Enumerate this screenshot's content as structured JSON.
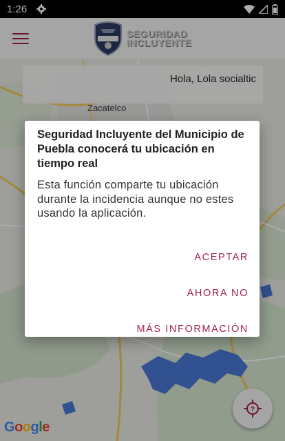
{
  "status_bar": {
    "time": "1:26",
    "icons": [
      "settings-gear-icon",
      "wifi-icon",
      "signal-icon",
      "battery-icon"
    ]
  },
  "app_bar": {
    "logo_line1": "SEGURIDAD",
    "logo_line2": "INCLUYENTE",
    "menu_icon": "hamburger-menu-icon"
  },
  "map": {
    "greeting": "Hola, Lola socialtic",
    "place_label": "Zacatelco",
    "attribution": "Google",
    "locate_icon": "locate-me-icon"
  },
  "dialog": {
    "title": "Seguridad Incluyente del Municipio de Puebla conocerá tu ubicación en tiempo real",
    "message": "Esta función comparte tu ubicación durante la incidencia aunque no estes usando la aplicación.",
    "buttons": {
      "accept": "ACEPTAR",
      "not_now": "AHORA NO",
      "more_info": "MÁS INFORMACIÓN"
    }
  },
  "colors": {
    "accent": "#a3204c",
    "status_bar": "#000000",
    "app_bar": "#f3f3f3",
    "map_background": "#e9ebe4",
    "water": "#4a78d6"
  }
}
